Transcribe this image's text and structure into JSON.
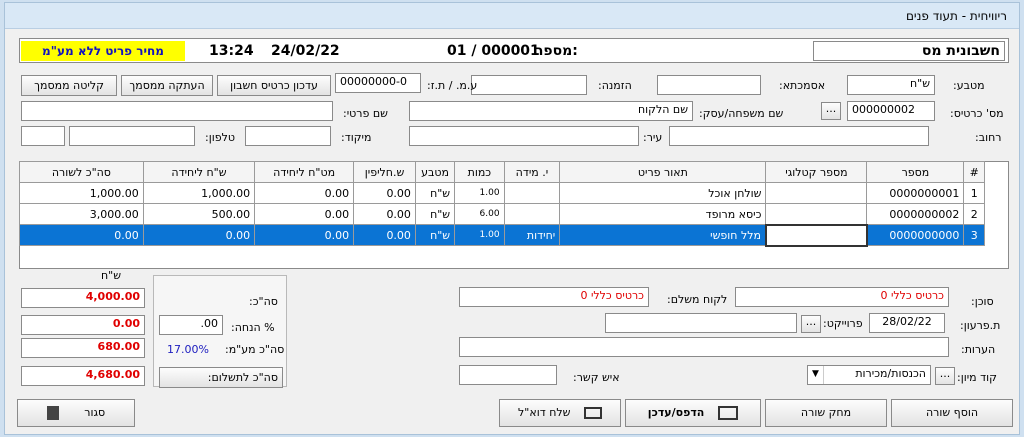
{
  "window": {
    "title": "ריוויחית - תעוד פנים"
  },
  "header": {
    "doc_type": "חשבונית מס",
    "number_label": "מספר:",
    "number_value": "01 / 000001",
    "date": "24/02/22",
    "time": "13:24",
    "price_mode": "מחיר פריט ללא מע\"מ"
  },
  "customer": {
    "currency_label": "מטבע:",
    "currency_value": "ש\"ח",
    "warehouse_label": "אסמכתא:",
    "warehouse_value": "",
    "order_label": "הזמנה:",
    "order_value": "",
    "vat_id_label": "ע.מ. / ת.ז:",
    "vat_id_value": "00000000-0",
    "card_label": "מס' כרטיס:",
    "card_value": "000000002",
    "lookup_btn": "...",
    "name_label": "שם משפחה/עסק:",
    "name_value": "שם הלקוח",
    "first_name_label": "שם פרטי:",
    "first_name_value": "",
    "street_label": "רחוב:",
    "street_value": "",
    "city_label": "עיר:",
    "city_value": "",
    "zip_label": "מיקוד:",
    "zip_value": "",
    "phone_label": "טלפון:",
    "phone_value": "",
    "extra_value": ""
  },
  "actions": {
    "update_card": "עדכון כרטיס חשבון",
    "copy_doc": "העתקה ממסמך",
    "import_doc": "קליטה ממסמך"
  },
  "grid": {
    "columns": [
      "#",
      "מספר",
      "מספר קטלוגי",
      "תאור פריט",
      "י. מידה",
      "כמות",
      "מטבע",
      "ש.חליפין",
      "מט\"ח ליחידה",
      "ש\"ח ליחידה",
      "סה\"כ לשורה"
    ],
    "rows": [
      {
        "idx": "1",
        "number": "0000000001",
        "catalog": "",
        "desc": "שולחן אוכל",
        "unit": "",
        "qty": "1.00",
        "currency": "ש\"ח",
        "rate": "0.00",
        "fx_unit": "0.00",
        "nis_unit": "1,000.00",
        "total": "1,000.00"
      },
      {
        "idx": "2",
        "number": "0000000002",
        "catalog": "",
        "desc": "כיסא מרופד",
        "unit": "",
        "qty": "6.00",
        "currency": "ש\"ח",
        "rate": "0.00",
        "fx_unit": "0.00",
        "nis_unit": "500.00",
        "total": "3,000.00"
      },
      {
        "idx": "3",
        "number": "0000000000",
        "catalog": "",
        "desc": "מלל חופשי",
        "unit": "יחידות",
        "qty": "1.00",
        "currency": "ש\"ח",
        "rate": "0.00",
        "fx_unit": "0.00",
        "nis_unit": "0.00",
        "total": "0.00"
      }
    ]
  },
  "totals": {
    "currency": "ש\"ח",
    "subtotal_label": "סה\"כ:",
    "subtotal": "4,000.00",
    "discount_label": "% הנחה:",
    "discount_pct": ".00",
    "discount": "0.00",
    "vat_label": "סה\"כ מע\"מ:",
    "vat_pct": "17.00%",
    "vat": "680.00",
    "pay_btn": "סה\"כ לתשלום:",
    "total": "4,680.00"
  },
  "footer": {
    "agent_label": "סוכן:",
    "agent_value": "כרטיס כללי 0",
    "payer_label": "לקוח משלם:",
    "payer_value": "כרטיס כללי 0",
    "due_label": "ת.פרעון:",
    "due_value": "28/02/22",
    "project_label": "פרוייקט:",
    "project_value": "",
    "notes_label": "הערות:",
    "notes_value": "",
    "sort_label": "קוד מיון:",
    "sort_value": "הכנסות/מכירות",
    "contact_label": "איש קשר:",
    "contact_value": ""
  },
  "buttons": {
    "close": "סגור",
    "send_email": "שלח דוא\"ל",
    "print": "הדפס/עדכן",
    "delete_row": "מחק שורה",
    "add_row": "הוסף שורה"
  }
}
